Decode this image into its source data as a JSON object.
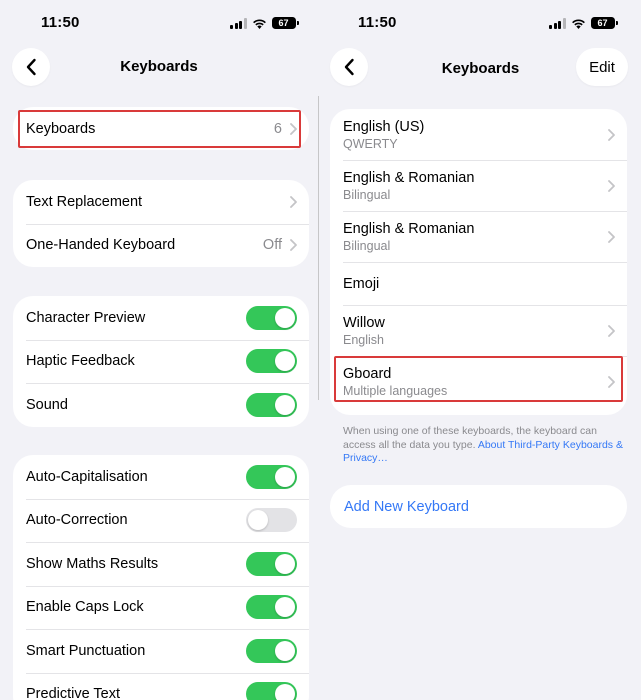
{
  "left": {
    "status": {
      "time": "11:50",
      "battery": "67"
    },
    "nav": {
      "title": "Keyboards"
    },
    "keyboards_row": {
      "label": "Keyboards",
      "count": "6"
    },
    "group2": [
      {
        "label": "Text Replacement",
        "detail": ""
      },
      {
        "label": "One-Handed Keyboard",
        "detail": "Off"
      }
    ],
    "group3": [
      {
        "label": "Character Preview",
        "on": true
      },
      {
        "label": "Haptic Feedback",
        "on": true
      },
      {
        "label": "Sound",
        "on": true
      }
    ],
    "group4": [
      {
        "label": "Auto-Capitalisation",
        "on": true
      },
      {
        "label": "Auto-Correction",
        "on": false
      },
      {
        "label": "Show Maths Results",
        "on": true
      },
      {
        "label": "Enable Caps Lock",
        "on": true
      },
      {
        "label": "Smart Punctuation",
        "on": true
      },
      {
        "label": "Predictive Text",
        "on": true
      }
    ]
  },
  "right": {
    "status": {
      "time": "11:50",
      "battery": "67"
    },
    "nav": {
      "title": "Keyboards",
      "edit_label": "Edit"
    },
    "keyboards": [
      {
        "name": "English (US)",
        "sub": "QWERTY"
      },
      {
        "name": "English & Romanian",
        "sub": "Bilingual"
      },
      {
        "name": "English & Romanian",
        "sub": "Bilingual"
      },
      {
        "name": "Emoji",
        "sub": ""
      },
      {
        "name": "Willow",
        "sub": "English"
      },
      {
        "name": "Gboard",
        "sub": "Multiple languages"
      }
    ],
    "footnote": {
      "text": "When using one of these keyboards, the keyboard can access all the data you type. ",
      "link": "About Third-Party Keyboards & Privacy…"
    },
    "add_keyboard": "Add New Keyboard"
  },
  "colors": {
    "accent": "#3478f6",
    "toggle_on": "#34c759",
    "highlight": "#d93a3a"
  }
}
